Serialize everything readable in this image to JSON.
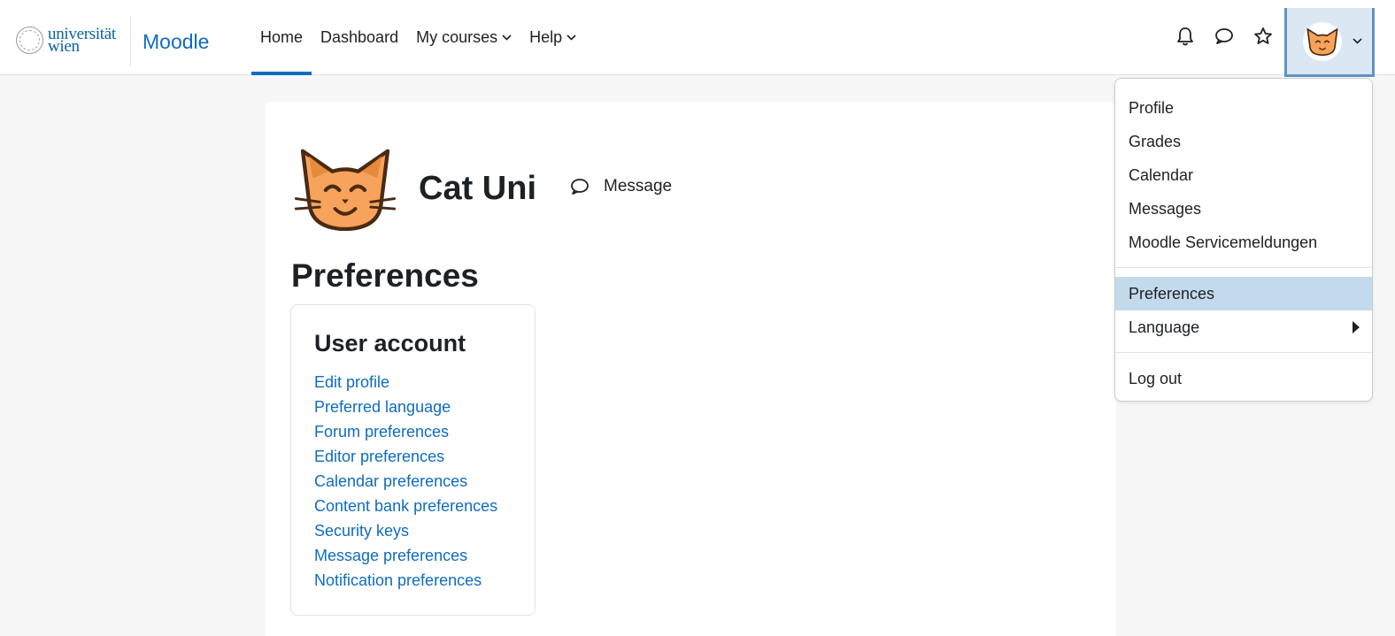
{
  "navbar": {
    "university_logo_text_1": "universität",
    "university_logo_text_2": "wien",
    "site_name": "Moodle",
    "menu": [
      {
        "label": "Home",
        "active": true
      },
      {
        "label": "Dashboard"
      },
      {
        "label": "My courses"
      },
      {
        "label": "Help"
      }
    ],
    "icons": [
      "bell-icon",
      "chat-icon",
      "star-icon"
    ],
    "user_avatar_icon": "cat-face-icon"
  },
  "profile": {
    "name": "Cat Uni",
    "message_label": "Message"
  },
  "page_title": "Preferences",
  "user_account": {
    "title": "User account",
    "links": [
      "Edit profile",
      "Preferred language",
      "Forum preferences",
      "Editor preferences",
      "Calendar preferences",
      "Content bank preferences",
      "Security keys",
      "Message preferences",
      "Notification preferences"
    ]
  },
  "user_dropdown": {
    "group1": [
      "Profile",
      "Grades",
      "Calendar",
      "Messages",
      "Moodle Servicemeldungen"
    ],
    "preferences": "Preferences",
    "language": "Language",
    "logout": "Log out"
  },
  "colors": {
    "brand_blue": "#0f6cbf",
    "selected_bg": "#c3d9ec",
    "page_bg": "#f7f7f7"
  }
}
